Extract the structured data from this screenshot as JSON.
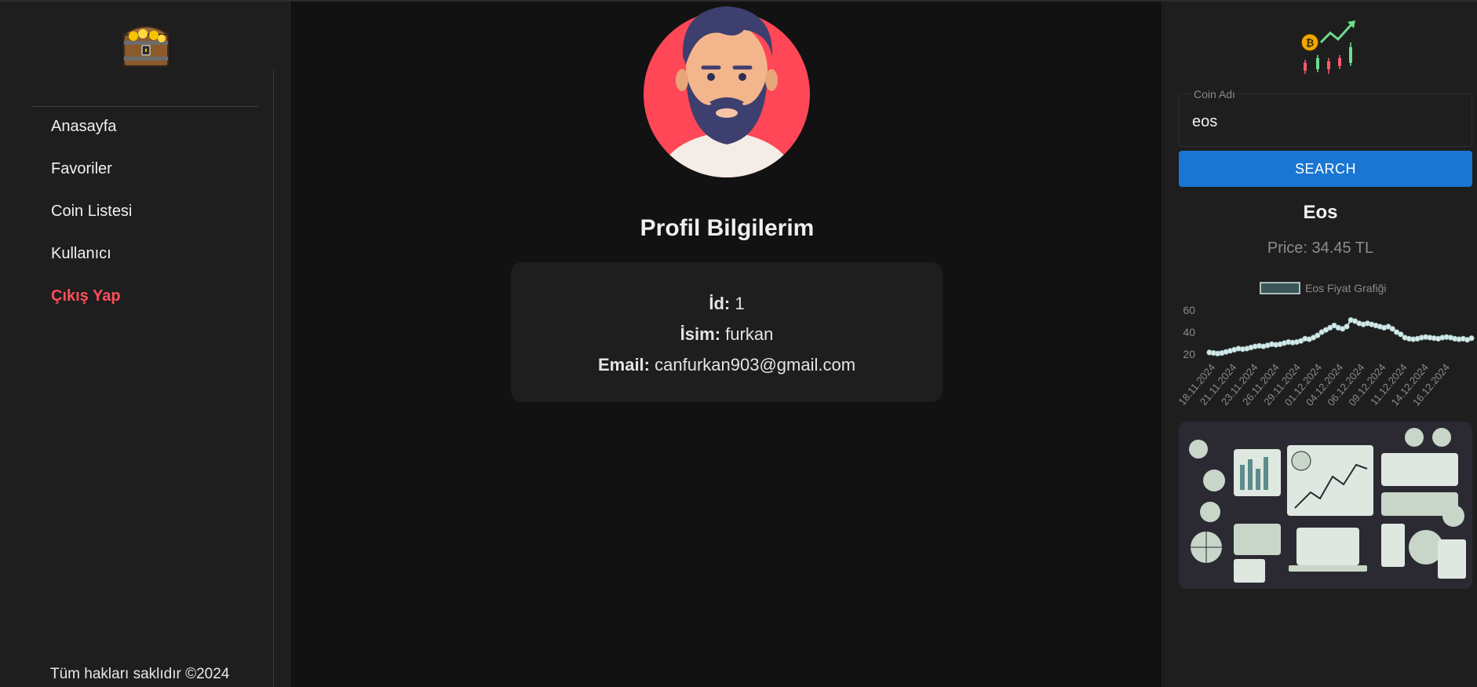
{
  "sidebar": {
    "logo_icon": "treasure-chest-icon",
    "items": [
      {
        "label": "Anasayfa"
      },
      {
        "label": "Favoriler"
      },
      {
        "label": "Coin Listesi"
      },
      {
        "label": "Kullanıcı"
      },
      {
        "label": "Çıkış Yap"
      }
    ],
    "footer": "Tüm hakları saklıdır ©2024"
  },
  "main": {
    "avatar_icon": "bearded-man-avatar",
    "title": "Profil Bilgilerim",
    "profile": {
      "id_label": "İd:",
      "id_value": "1",
      "name_label": "İsim:",
      "name_value": "furkan",
      "email_label": "Email:",
      "email_value": "canfurkan903@gmail.com"
    }
  },
  "right": {
    "header_icon": "crypto-trend-icon",
    "search": {
      "legend": "Coin Adı",
      "value": "eos"
    },
    "search_button": "SEARCH",
    "coin_name": "Eos",
    "price": "Price: 34.45 TL",
    "illustration_icon": "crypto-dashboard-illustration"
  },
  "colors": {
    "accent": "#1976d2",
    "danger": "#ff4d5a",
    "avatar_bg": "#ff4757",
    "chart_line": "#d6eaea"
  },
  "chart_data": {
    "type": "line",
    "legend": [
      "Eos Fiyat Grafiği"
    ],
    "yticks": [
      20,
      40,
      60
    ],
    "ylim": [
      15,
      65
    ],
    "xticks": [
      "18.11.2024",
      "21.11.2024",
      "23.11.2024",
      "26.11.2024",
      "29.11.2024",
      "01.12.2024",
      "04.12.2024",
      "06.12.2024",
      "09.12.2024",
      "11.12.2024",
      "14.12.2024",
      "16.12.2024"
    ],
    "series": [
      {
        "name": "Eos Fiyat Grafiği",
        "values": [
          21.5,
          21,
          20.5,
          21,
          22,
          23,
          24,
          25,
          24.5,
          25,
          26,
          27,
          27.5,
          27,
          28,
          29,
          28.5,
          29,
          30,
          31,
          30.5,
          31,
          32,
          34,
          33.5,
          35,
          37,
          40,
          42,
          44,
          46,
          44,
          43,
          45,
          51,
          50,
          48,
          47,
          48,
          47,
          46,
          45,
          44,
          45,
          43,
          40,
          38,
          35,
          34,
          33.5,
          34,
          35,
          35.5,
          35,
          34.5,
          34,
          35,
          35.5,
          35,
          34,
          33.5,
          34,
          33,
          34.45
        ]
      }
    ]
  }
}
